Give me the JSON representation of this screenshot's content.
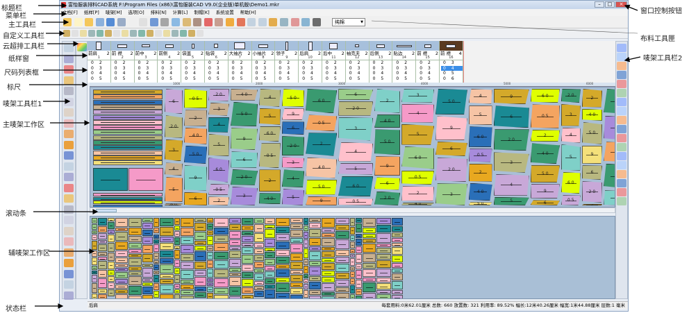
{
  "annotations": {
    "left": [
      "标题栏",
      "菜单栏",
      "主工具栏",
      "自定义工具栏",
      "云超排工具栏",
      "纸样窗",
      "尺码列表框",
      "标尺",
      "唛架工具栏1",
      "主唛架工作区",
      "滚动条",
      "辅唛架工作区",
      "状态栏"
    ],
    "right": [
      "窗口控制按钮",
      "布料工具匣",
      "唛架工具栏2"
    ]
  },
  "window": {
    "title": "富怡服装排料CAD系统 F:\\Program Files (x86)\\富怡服装CAD V9.0(企业版)单机版\\Demo1.mkr",
    "controls": [
      "–",
      "□",
      "×"
    ]
  },
  "menu": [
    "文档[F]",
    "纸样[P]",
    "唛架[M]",
    "选项[O]",
    "排料[N]",
    "计算[L]",
    "制帽[K]",
    "系统设置",
    "帮助[H]"
  ],
  "fabric_select": {
    "value": "纯棉"
  },
  "pieces": [
    {
      "name": "前肩",
      "count": "2",
      "index": "1",
      "sizes": [
        "2",
        "3",
        "4",
        "5"
      ],
      "sel": 0
    },
    {
      "name": "前 襟",
      "count": "2",
      "index": "2",
      "sizes": [
        "2",
        "3",
        "4",
        "5"
      ],
      "sel": 0
    },
    {
      "name": "前中",
      "count": "2",
      "index": "3",
      "sizes": [
        "2",
        "3",
        "4",
        "5"
      ],
      "sel": 0
    },
    {
      "name": "前侧",
      "count": "2",
      "index": "4",
      "sizes": [
        "2",
        "3",
        "4",
        "5"
      ],
      "sel": 0
    },
    {
      "name": "袋盖",
      "count": "2",
      "index": "5",
      "sizes": [
        "2",
        "3",
        "4",
        "5"
      ],
      "sel": 0
    },
    {
      "name": "贴袋",
      "count": "2",
      "index": "6",
      "sizes": [
        "2",
        "3",
        "4",
        "5"
      ],
      "sel": 0
    },
    {
      "name": "大袖片",
      "count": "2",
      "index": "7",
      "sizes": [
        "2",
        "3",
        "4",
        "5"
      ],
      "sel": 0
    },
    {
      "name": "小袖片",
      "count": "2",
      "index": "8",
      "sizes": [
        "2",
        "3",
        "4",
        "5"
      ],
      "sel": 0
    },
    {
      "name": "领子",
      "count": "2",
      "index": "9",
      "sizes": [
        "2",
        "3",
        "4",
        "5"
      ],
      "sel": 0
    },
    {
      "name": "后肩",
      "count": "2",
      "index": "10",
      "sizes": [
        "2",
        "3",
        "4",
        "5"
      ],
      "sel": 0
    },
    {
      "name": "后中",
      "count": "2",
      "index": "11",
      "sizes": [
        "2",
        "3",
        "4",
        "5"
      ],
      "sel": 0
    },
    {
      "name": "袖克夫",
      "count": "2",
      "index": "12",
      "sizes": [
        "2",
        "3",
        "4",
        "5"
      ],
      "sel": 0
    },
    {
      "name": "后侧",
      "count": "2",
      "index": "13",
      "sizes": [
        "2",
        "3",
        "4",
        "5"
      ],
      "sel": 0
    },
    {
      "name": "贴边",
      "count": "2",
      "index": "14",
      "sizes": [
        "2",
        "3",
        "4",
        "5"
      ],
      "sel": 0
    },
    {
      "name": "前 襟",
      "count": "2",
      "index": "15",
      "sizes": [
        "2",
        "3",
        "4",
        "5"
      ],
      "sel": 0
    },
    {
      "name": "前 襟",
      "count": "4",
      "index": "16",
      "sizes": [
        "3",
        "4",
        "5",
        "6"
      ],
      "sel": 1
    }
  ],
  "size_qty": "0",
  "ruler_labels": [
    "1000",
    "2000",
    "3000",
    "4000",
    "5000",
    "6000"
  ],
  "piece_labels": [
    "6",
    "2 0",
    "3",
    "4",
    "5",
    "6 0",
    "0 5",
    "2",
    "4 0",
    "5 0",
    "9"
  ],
  "colors": [
    "#d4a92a",
    "#f59ac8",
    "#f4e07a",
    "#c8a8d8",
    "#1a8a94",
    "#f4a460",
    "#9acd8a",
    "#dfff00",
    "#a78bdb",
    "#f6c4a5",
    "#2a6fb8",
    "#b8b880",
    "#7fd0c8",
    "#ffc0cb",
    "#e8a820",
    "#c8b090",
    "#3a9a70"
  ],
  "status": {
    "left": "后肩",
    "right": "每套用料:0米62.01厘米  总数: 660  放置数: 321  利用率: 89.52%  幅长:12米40.26厘米  幅宽:1米44.88厘米  层数:1  毫米"
  }
}
